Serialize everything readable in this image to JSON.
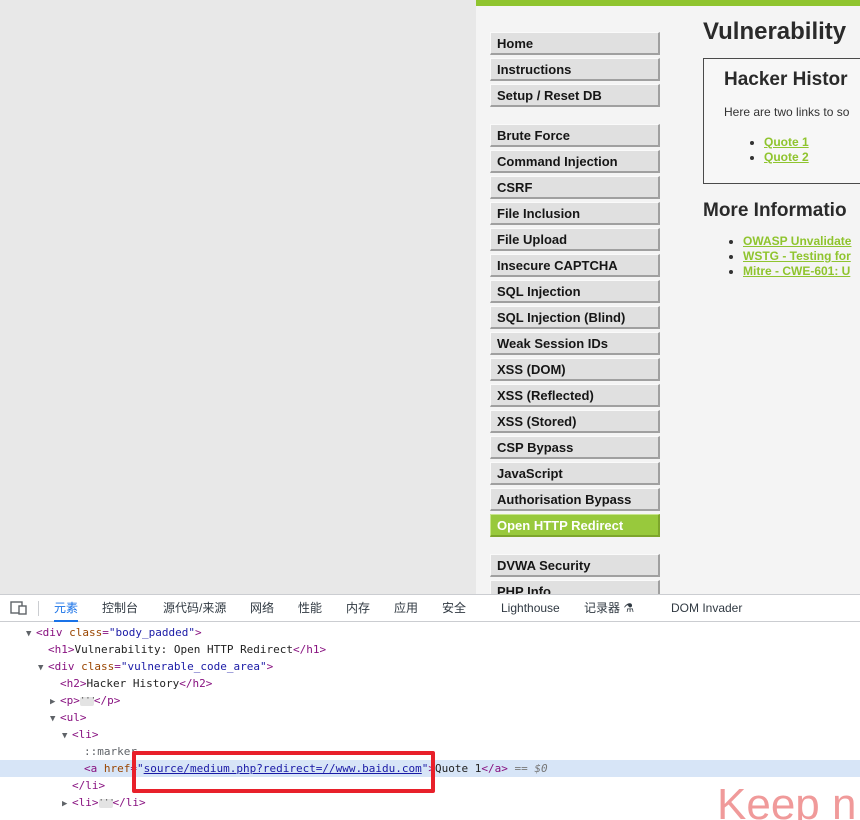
{
  "colors": {
    "accent_green": "#8fc42e",
    "devtools_blue": "#1a73e8",
    "highlight_red": "#e8202a"
  },
  "menu": {
    "group1": [
      "Home",
      "Instructions",
      "Setup / Reset DB"
    ],
    "group2": [
      "Brute Force",
      "Command Injection",
      "CSRF",
      "File Inclusion",
      "File Upload",
      "Insecure CAPTCHA",
      "SQL Injection",
      "SQL Injection (Blind)",
      "Weak Session IDs",
      "XSS (DOM)",
      "XSS (Reflected)",
      "XSS (Stored)",
      "CSP Bypass",
      "JavaScript",
      "Authorisation Bypass",
      "Open HTTP Redirect"
    ],
    "group3": [
      "DVWA Security",
      "PHP Info"
    ],
    "selected": "Open HTTP Redirect"
  },
  "content": {
    "title": "Vulnerability",
    "box_heading": "Hacker Histor",
    "box_text": "Here are two links to so",
    "quotes": [
      "Quote 1",
      "Quote 2"
    ],
    "more_heading": "More Informatio",
    "info_links": [
      "OWASP Unvalidate",
      "WSTG - Testing for",
      "Mitre - CWE-601: U"
    ]
  },
  "devtools": {
    "device_icon": "device-toggle-icon",
    "tabs": [
      "元素",
      "控制台",
      "源代码/来源",
      "网络",
      "性能",
      "内存",
      "应用",
      "安全",
      "Lighthouse",
      "记录器 ⚗",
      "DOM Invader"
    ],
    "active_tab": "元素",
    "dom": {
      "l1_tag": "div",
      "l1_attr": "class",
      "l1_val": "\"body_padded\"",
      "l2_text": "Vulnerability: Open HTTP Redirect",
      "l3_tag": "div",
      "l3_attr": "class",
      "l3_val": "\"vulnerable_code_area\"",
      "l4_text": "Hacker History",
      "l5_tag": "p",
      "l6_tag": "ul",
      "l7_tag": "li",
      "l8_pseudo": "::marker",
      "l9_tag": "a",
      "l9_attr": "href",
      "l9_val": "source/medium.php?redirect=//www.baidu.com",
      "l9_text": "Quote 1",
      "l9_suffix": "== $0",
      "l10_tag": "li",
      "l11_tag": "li"
    }
  },
  "watermark": "Keep n"
}
